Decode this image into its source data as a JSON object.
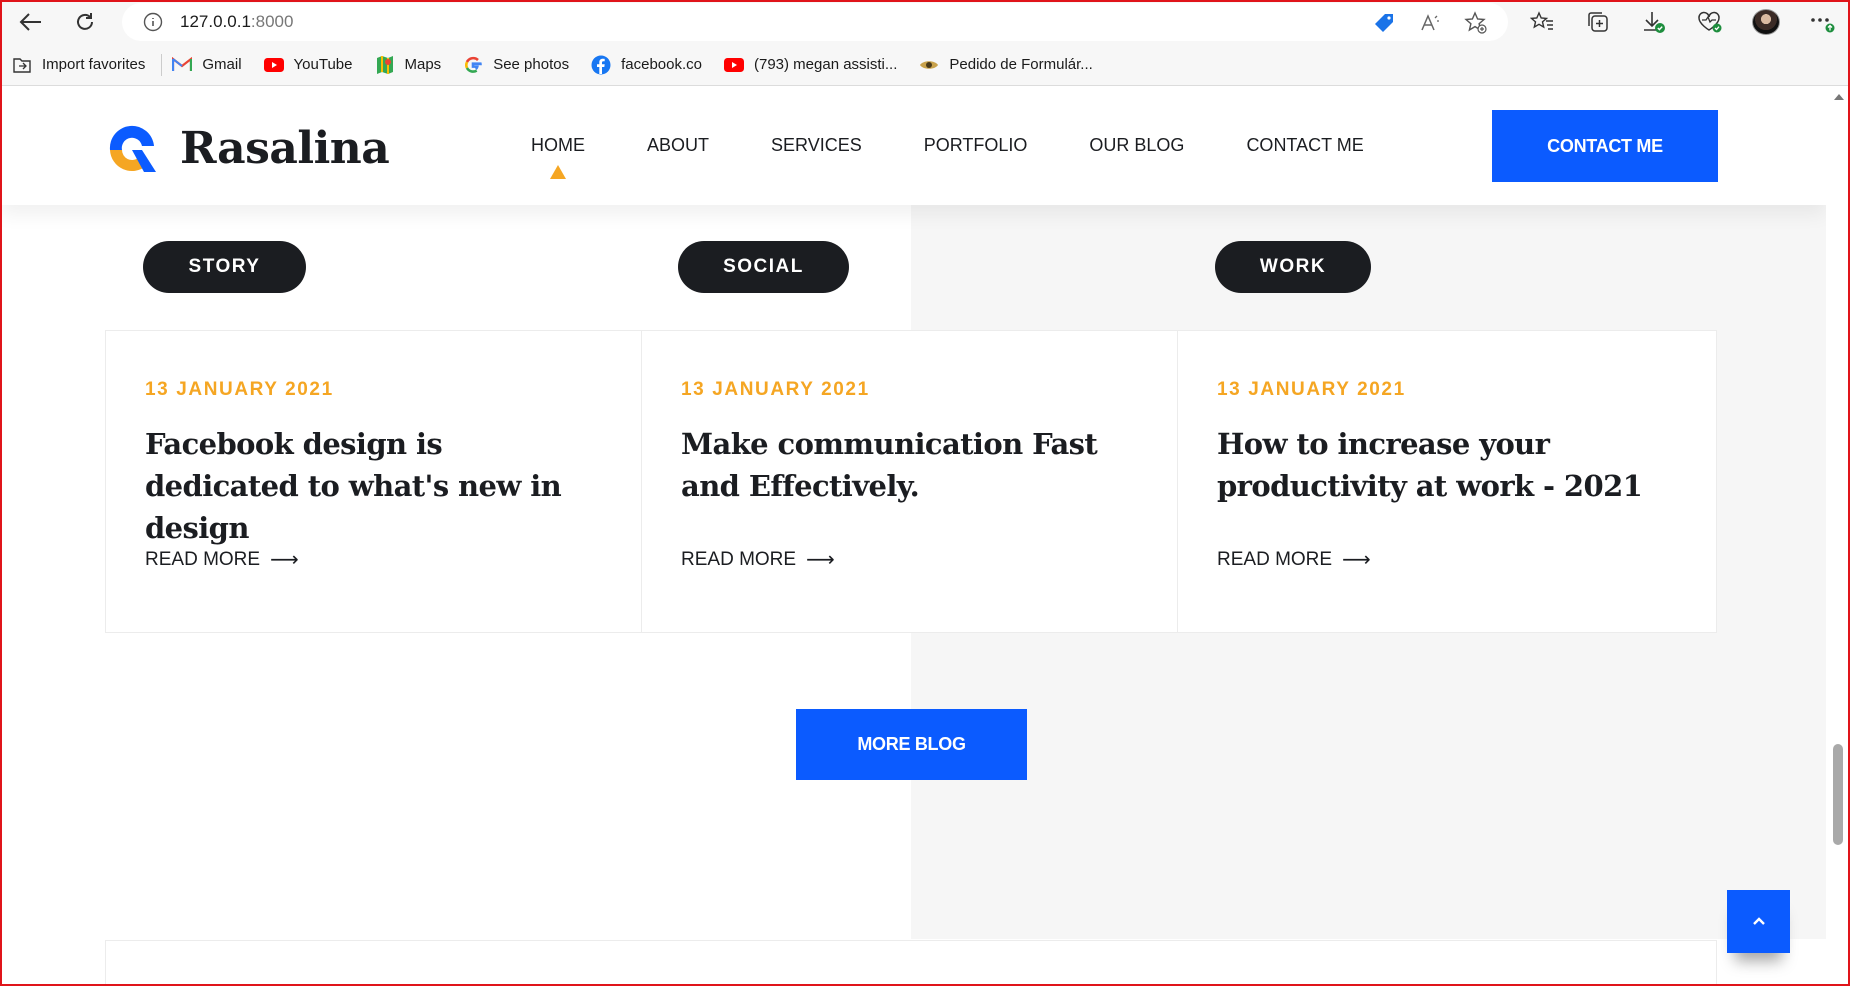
{
  "browser": {
    "url_host": "127.0.0.1",
    "url_port": ":8000",
    "bookmarks": [
      {
        "label": "Import favorites",
        "icon": "import-icon"
      },
      {
        "label": "Gmail",
        "icon": "gmail-icon"
      },
      {
        "label": "YouTube",
        "icon": "youtube-icon"
      },
      {
        "label": "Maps",
        "icon": "maps-icon"
      },
      {
        "label": "See photos",
        "icon": "google-icon"
      },
      {
        "label": "facebook.co",
        "icon": "facebook-icon"
      },
      {
        "label": "(793) megan assisti...",
        "icon": "youtube-icon"
      },
      {
        "label": "Pedido de Formulár...",
        "icon": "eye-icon"
      }
    ]
  },
  "site": {
    "brand": "Rasalina",
    "nav": [
      "HOME",
      "ABOUT",
      "SERVICES",
      "PORTFOLIO",
      "OUR BLOG",
      "CONTACT ME"
    ],
    "contact_button": "CONTACT ME",
    "accent_color": "#0b5bff",
    "highlight_color": "#f5a623"
  },
  "blog": {
    "tags": [
      "STORY",
      "SOCIAL",
      "WORK"
    ],
    "posts": [
      {
        "date": "13 JANUARY 2021",
        "title": "Facebook design is dedicated to what's new in design",
        "read_more": "READ MORE"
      },
      {
        "date": "13 JANUARY 2021",
        "title": "Make communication Fast and Effectively.",
        "read_more": "READ MORE"
      },
      {
        "date": "13 JANUARY 2021",
        "title": "How to increase your productivity at work - 2021",
        "read_more": "READ MORE"
      }
    ],
    "more_button": "MORE BLOG"
  }
}
